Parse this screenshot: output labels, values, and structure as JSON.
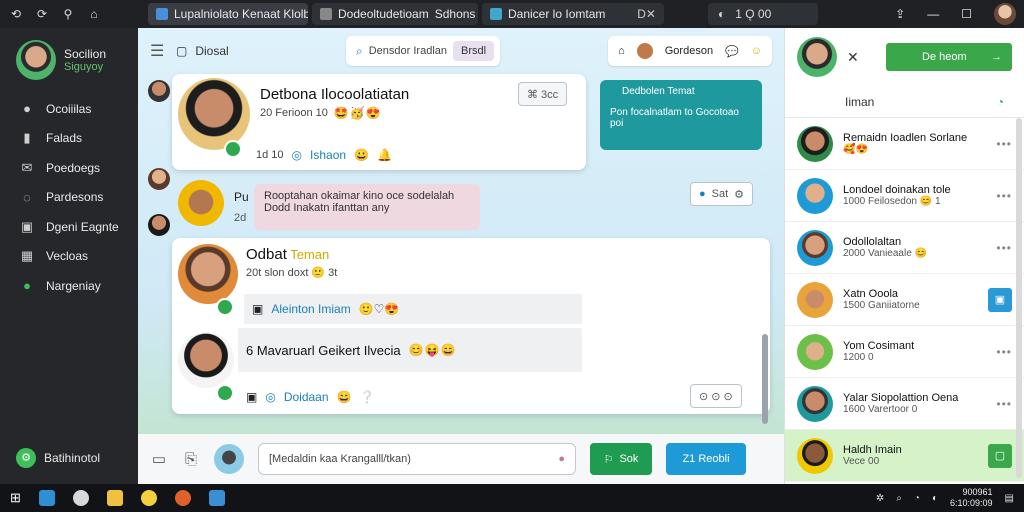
{
  "titlebar": {
    "icons": [
      "⟲",
      "⟳",
      "⚲",
      "⌂"
    ],
    "tabs": [
      {
        "label": "Lupalniolato Kenaat Klolbitoa",
        "active": true
      },
      {
        "label": "Dodeoltudetioam",
        "extra": "Sdhons",
        "active": false
      },
      {
        "label": "Danicer lo Iomtam",
        "active": false
      }
    ],
    "tab3_close": "D✕",
    "extra_label": "1 Ǫ 00",
    "extra_icon": "◐"
  },
  "sidebar": {
    "user_name": "Socilion",
    "user_status": "Siguyoy",
    "items": [
      {
        "icon": "●",
        "label": "Ocoiiilas"
      },
      {
        "icon": "▮",
        "label": "Falads"
      },
      {
        "icon": "✉",
        "label": "Poedoegs"
      },
      {
        "icon": "◌",
        "label": "Pardesons"
      },
      {
        "icon": "▣",
        "label": "Dgeni Eagnte"
      },
      {
        "icon": "▦",
        "label": "Vecloas"
      },
      {
        "icon": "●",
        "label": "Nargeniay"
      }
    ],
    "footer_label": "Batihinotol"
  },
  "topbar": {
    "title": "Diosal",
    "search_text": "Densdor Iradlan",
    "search_chip": "Brsdl",
    "actions_label": "Gordeson"
  },
  "messages": [
    {
      "name": "Detbona Ilocoolatiatan",
      "meta": "20 Ferioon 10",
      "reactions": "🤩🥳😍",
      "footer_meta": "1d 10",
      "link": "Ishaon",
      "pill": "⌘ 3cc",
      "teal_title": "Dedbolen Temat",
      "teal_body": "Pon focalnatlam to Gocotoao poi",
      "pink_text": "Rooptahan okaimar kino oce sodelalah\nDodd Inakatn ifanttan any",
      "pink_name": "Pu",
      "pink_time": "2d",
      "side_pill": "Sat"
    },
    {
      "name": "Odbat",
      "name_hl": "Teman",
      "meta": "20t slon doxt 🙂 3t",
      "strip_link": "Aleinton Imiam",
      "strip_reacts": "🙂♡😍"
    },
    {
      "name": "6 Mavaruarl Geikert Ilvecia",
      "reactions": "😊😝😄",
      "footer_link": "Doidaan",
      "footer_icon": "❔",
      "right_icons": "⊙ ⊙ ⊙"
    }
  ],
  "composer": {
    "placeholder": "[Medaldin kaa Krangalll/tkan)",
    "send_label": "Sok",
    "reply_label": "Z1 Reobli"
  },
  "right_panel": {
    "button_label": "De heom",
    "header": "Iiman",
    "contacts": [
      {
        "name": "Remaidn Ioadlen Sorlane",
        "sub": "🥰😍",
        "action": "more"
      },
      {
        "name": "Londoel doinakan tole",
        "sub": "1000 Feilosedon 😊 1",
        "action": "more"
      },
      {
        "name": "Odollolaltan",
        "sub": "2000 Vanieaale 😊",
        "action": "more"
      },
      {
        "name": "Xatn Ooola",
        "sub": "1500 Ganiiatorne",
        "action": "square"
      },
      {
        "name": "Yom Cosimant",
        "sub": "1200 0",
        "action": "more"
      },
      {
        "name": "Yalar Siopolattion Oena",
        "sub": "1600 Varertoor 0",
        "action": "more"
      },
      {
        "name": "Haldh Imain",
        "sub": "Vece 00",
        "action": "square",
        "selected": true
      }
    ]
  },
  "taskbar": {
    "clock_time": "900961",
    "clock_date": "6:10:09:09"
  },
  "colors": {
    "accent_green": "#3aa84a",
    "accent_blue": "#1e9ad6",
    "teal": "#1e9a9f",
    "sidebar_bg": "#25272b"
  }
}
